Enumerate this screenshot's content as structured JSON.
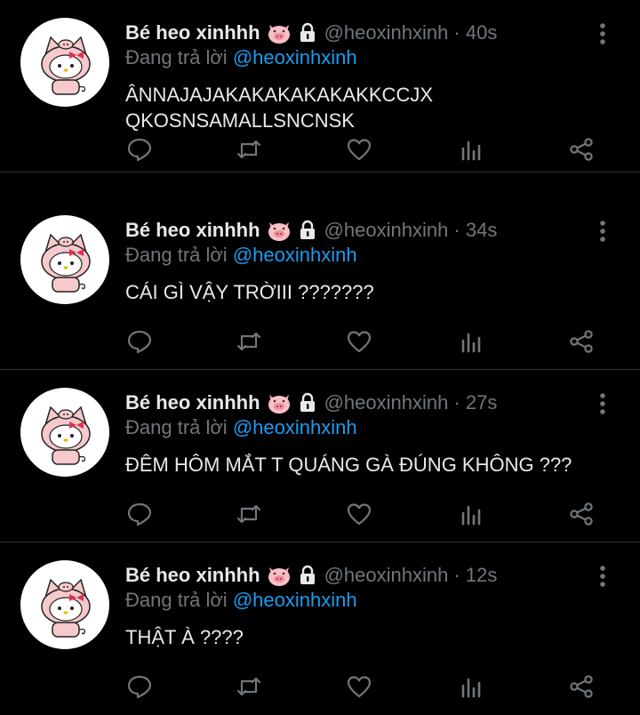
{
  "tweets": [
    {
      "name": "Bé heo xinhhh",
      "handle_time": "@heoxinhxinh · 40s",
      "reply_prefix": "Đang trả lời",
      "reply_to": "@heoxinhxinh",
      "lines": [
        "ÂNNAJAJAKAKAKAKAKAKKCCJX",
        "QKOSNSAMALLSNCNSK"
      ]
    },
    {
      "name": "Bé heo xinhhh",
      "handle_time": "@heoxinhxinh · 34s",
      "reply_prefix": "Đang trả lời",
      "reply_to": "@heoxinhxinh",
      "lines": [
        "CÁI GÌ VẬY TRỜIII ???????"
      ]
    },
    {
      "name": "Bé heo xinhhh",
      "handle_time": "@heoxinhxinh · 27s",
      "reply_prefix": "Đang trả lời",
      "reply_to": "@heoxinhxinh",
      "lines": [
        "ĐÊM HÔM MẮT T QUÁNG GÀ ĐÚNG KHÔNG ???"
      ]
    },
    {
      "name": "Bé heo xinhhh",
      "handle_time": "@heoxinhxinh · 12s",
      "reply_prefix": "Đang trả lời",
      "reply_to": "@heoxinhxinh",
      "lines": [
        "THẬT À ????"
      ]
    }
  ],
  "icons": {
    "name_emoji": "pig-face-icon",
    "protected": "lock-icon",
    "more": "more-vertical-icon",
    "actions": [
      "reply-icon",
      "retweet-icon",
      "like-icon",
      "analytics-icon",
      "share-icon"
    ]
  },
  "colors": {
    "background": "#000000",
    "text": "#e7e9ea",
    "muted": "#71767b",
    "link": "#1d9bf0",
    "divider": "#2f3336"
  }
}
